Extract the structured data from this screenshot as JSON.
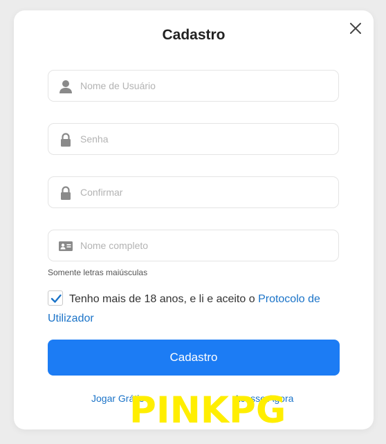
{
  "modal": {
    "title": "Cadastro"
  },
  "fields": {
    "username": {
      "placeholder": "Nome de Usuário",
      "value": "",
      "icon": "user-icon"
    },
    "password": {
      "placeholder": "Senha",
      "value": "",
      "icon": "lock-icon"
    },
    "confirm": {
      "placeholder": "Confirmar",
      "value": "",
      "icon": "lock-icon"
    },
    "fullname": {
      "placeholder": "Nome completo",
      "value": "",
      "icon": "id-card-icon",
      "hint": "Somente letras maiúsculas"
    }
  },
  "agreement": {
    "checked": true,
    "text": "Tenho mais de 18 anos, e li e aceito o ",
    "link_text": "Protocolo de Utilizador"
  },
  "actions": {
    "submit_label": "Cadastro",
    "play_free_label": "Jogar Grátis",
    "login_label": "Acesse Agora"
  },
  "watermark": {
    "text": "PINKPG"
  },
  "colors": {
    "primary": "#1c7cf4",
    "link": "#1a73c8",
    "icon": "#8a8a8a",
    "watermark": "#ffee00"
  }
}
